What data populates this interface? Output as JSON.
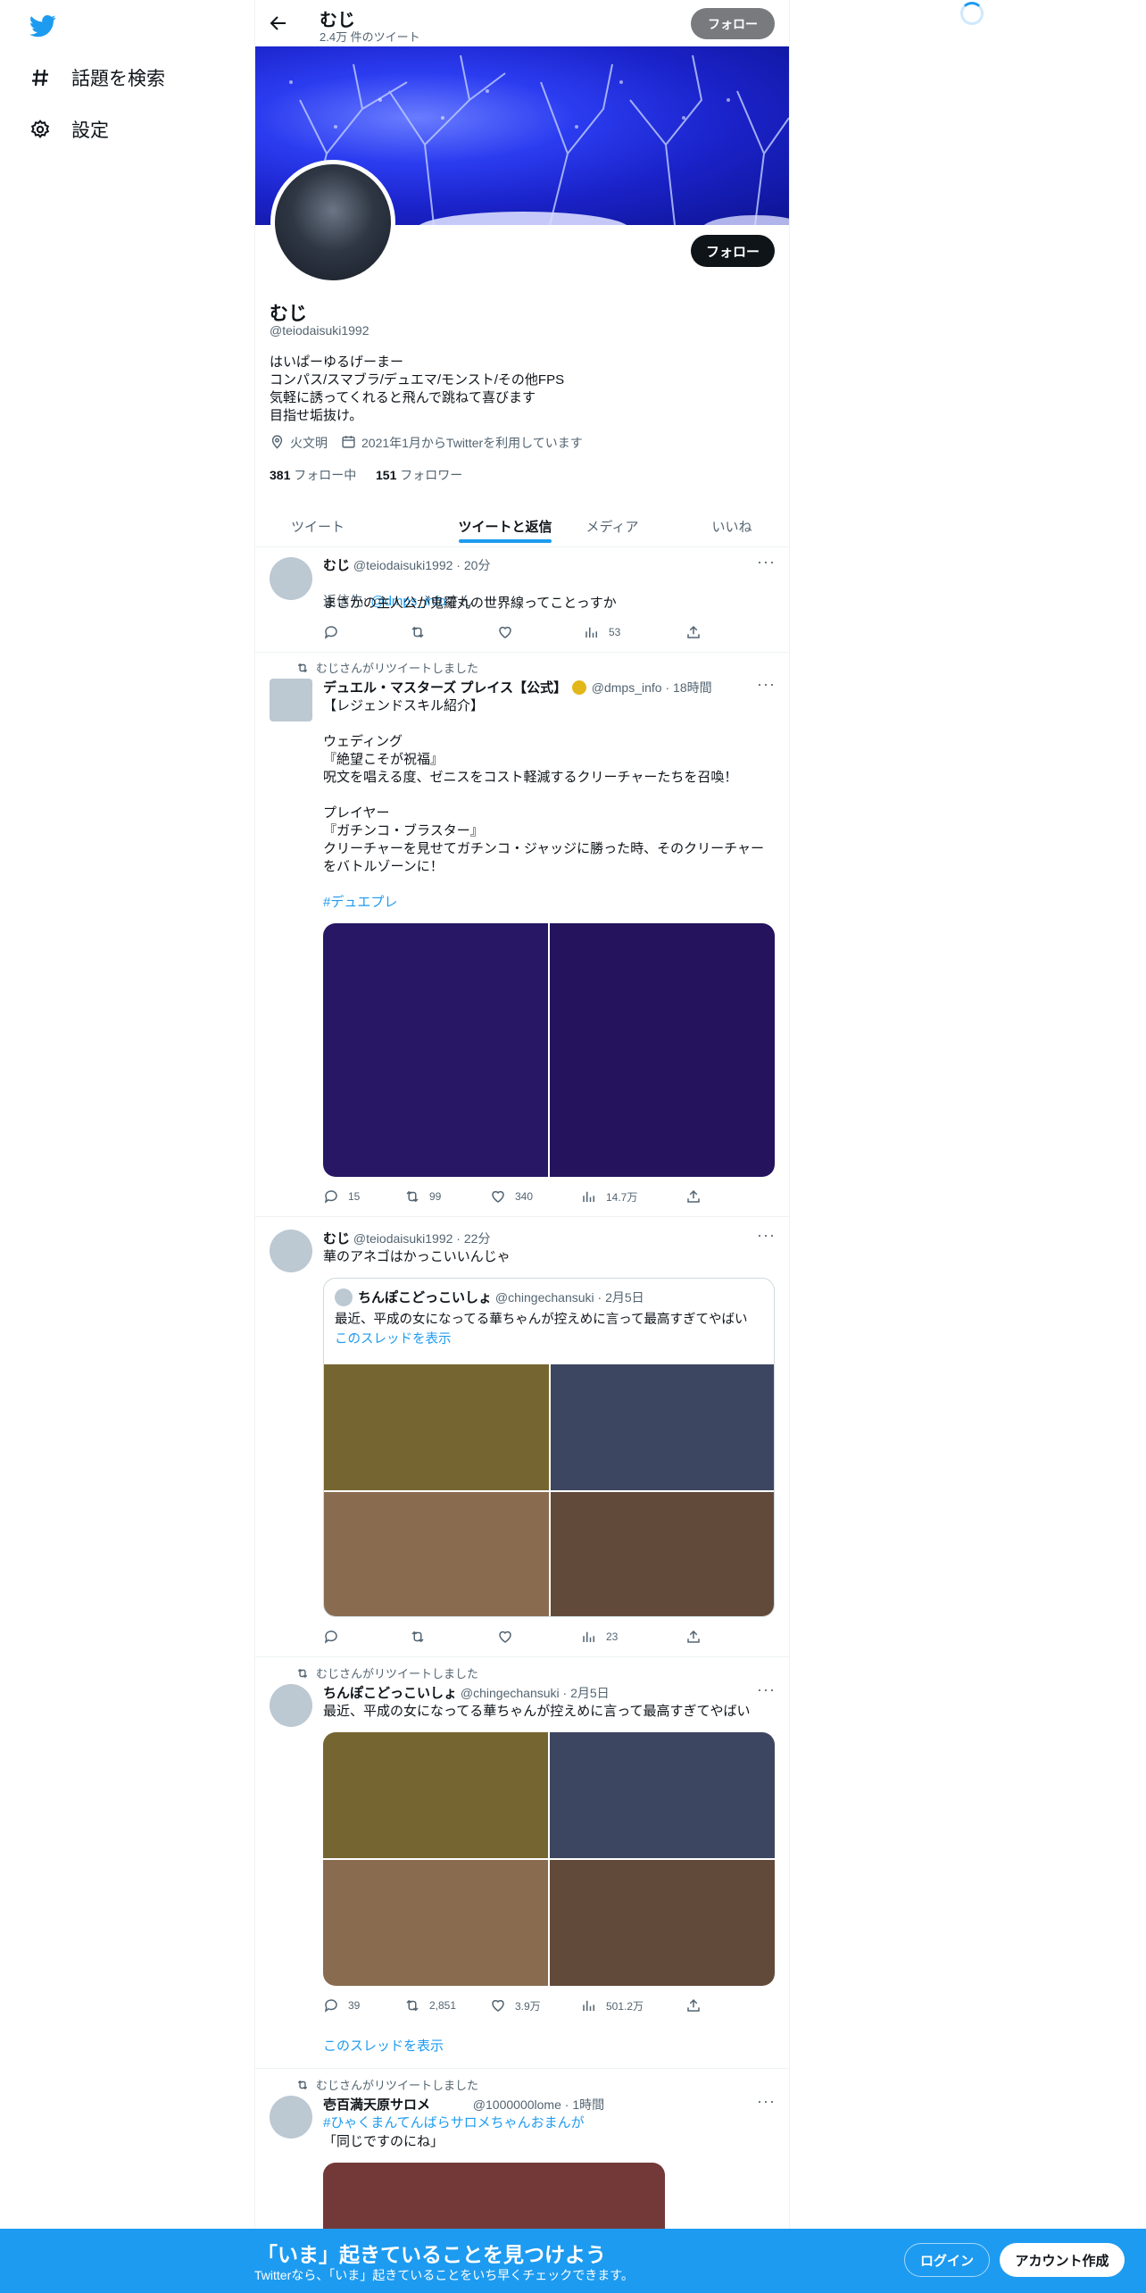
{
  "sidebar": {
    "logo_icon": "twitter-bird-icon",
    "items": [
      {
        "label": "話題を検索",
        "icon": "hashtag-icon"
      },
      {
        "label": "設定",
        "icon": "gear-icon"
      }
    ]
  },
  "header": {
    "name": "むじ",
    "tweet_count": "2.4万 件のツイート",
    "follow_label": "フォロー"
  },
  "profile": {
    "name": "むじ",
    "handle": "@teiodaisuki1992",
    "bio": "はいぱーゆるげーまー\nコンパス/スマブラ/デュエマ/モンスト/その他FPS\n気軽に誘ってくれると飛んで跳ねて喜びます\n目指せ垢抜け。",
    "location": "火文明",
    "joined": "2021年1月からTwitterを利用しています",
    "following_count": "381",
    "following_label": "フォロー中",
    "followers_count": "151",
    "followers_label": "フォロワー",
    "follow_label": "フォロー"
  },
  "tabs": [
    "ツイート",
    "ツイートと返信",
    "メディア",
    "いいね"
  ],
  "tweets": [
    {
      "name": "むじ",
      "handle": "@teiodaisuki1992",
      "time": "20分",
      "reply_to_prefix": "返信先: ",
      "reply_to": "@dmps_info",
      "reply_to_suffix": "さん",
      "text": "まさかの主人公が鬼羅丸の世界線ってことっすか",
      "views": "53"
    },
    {
      "retweet_label": "むじさんがリツイートしました",
      "name": "デュエル・マスターズ プレイス【公式】",
      "handle": "@dmps_info",
      "time": "18時間",
      "text": "【レジェンドスキル紹介】\n\nウェディング\n『絶望こそが祝福』\n呪文を唱える度、ゼニスをコスト軽減するクリーチャーたちを召喚！\n\nプレイヤー\n『ガチンコ・ブラスター』\nクリーチャーを見せてガチンコ・ジャッジに勝った時、そのクリーチャーをバトルゾーンに！",
      "hashtag": "#デュエプレ",
      "replies": "15",
      "retweets": "99",
      "likes": "340",
      "views": "14.7万"
    },
    {
      "name": "むじ",
      "handle": "@teiodaisuki1992",
      "time": "22分",
      "text": "華のアネゴはかっこいいんじゃ",
      "quote": {
        "name": "ちんぽこどっこいしょ",
        "handle": "@chingechansuki",
        "time": "2月5日",
        "text": "最近、平成の女になってる華ちゃんが控えめに言って最高すぎてやばい",
        "thread_link": "このスレッドを表示"
      },
      "views": "23"
    },
    {
      "retweet_label": "むじさんがリツイートしました",
      "name": "ちんぽこどっこいしょ",
      "handle": "@chingechansuki",
      "time": "2月5日",
      "text": "最近、平成の女になってる華ちゃんが控えめに言って最高すぎてやばい",
      "replies": "39",
      "retweets": "2,851",
      "likes": "3.9万",
      "views": "501.2万",
      "thread_link": "このスレッドを表示"
    },
    {
      "retweet_label": "むじさんがリツイートしました",
      "name": "壱百満天原サロメ",
      "handle": "@1000000lome",
      "time": "1時間",
      "hashtag": "#ひゃくまんてんばらサロメちゃんおまんが",
      "text": "「同じですのにね」"
    }
  ],
  "bottom_bar": {
    "title": "「いま」起きていることを見つけよう",
    "subtitle": "Twitterなら、「いま」起きていることをいち早くチェックできます。",
    "login_label": "ログイン",
    "signup_label": "アカウント作成"
  },
  "colors": {
    "accent": "#1d9bf0",
    "banner_blue": "#2b3cf0",
    "image_purple": "#271765",
    "tile_olive": "#756530",
    "tile_slate": "#3d4660",
    "tile_tan": "#896c50",
    "tile_brown": "#624a3a",
    "tile_maroon": "#733838"
  }
}
